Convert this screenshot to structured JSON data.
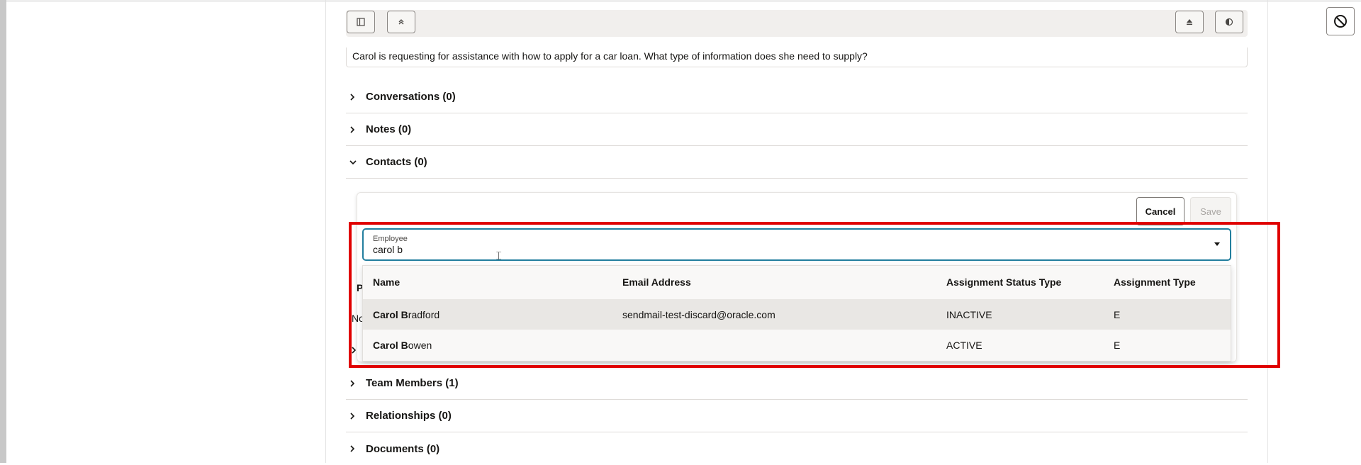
{
  "toolbar": {
    "left_buttons": [
      "panel-toggle-icon",
      "collapse-up-icon"
    ],
    "right_buttons": [
      "eject-icon",
      "contrast-icon"
    ]
  },
  "question": "Carol is requesting for assistance with how to apply for a car loan. What type of information does she need to supply?",
  "sections": {
    "conversations": "Conversations (0)",
    "notes": "Notes (0)",
    "contacts": "Contacts (0)",
    "team_members": "Team Members (1)",
    "relationships": "Relationships (0)",
    "documents": "Documents (0)"
  },
  "contacts_panel": {
    "cancel_label": "Cancel",
    "save_label": "Save",
    "behind_letter_p": "P",
    "behind_text_no": "No"
  },
  "employee_field": {
    "label": "Employee",
    "value": "carol b"
  },
  "dropdown": {
    "columns": [
      "Name",
      "Email Address",
      "Assignment Status Type",
      "Assignment Type"
    ],
    "rows": [
      {
        "name_match": "Carol B",
        "name_rest": "radford",
        "email": "sendmail-test-discard@oracle.com",
        "status": "INACTIVE",
        "type": "E"
      },
      {
        "name_match": "Carol B",
        "name_rest": "owen",
        "email": "",
        "status": "ACTIVE",
        "type": "E"
      }
    ]
  },
  "colors": {
    "accent": "#227e9e",
    "highlight": "#e00000"
  }
}
